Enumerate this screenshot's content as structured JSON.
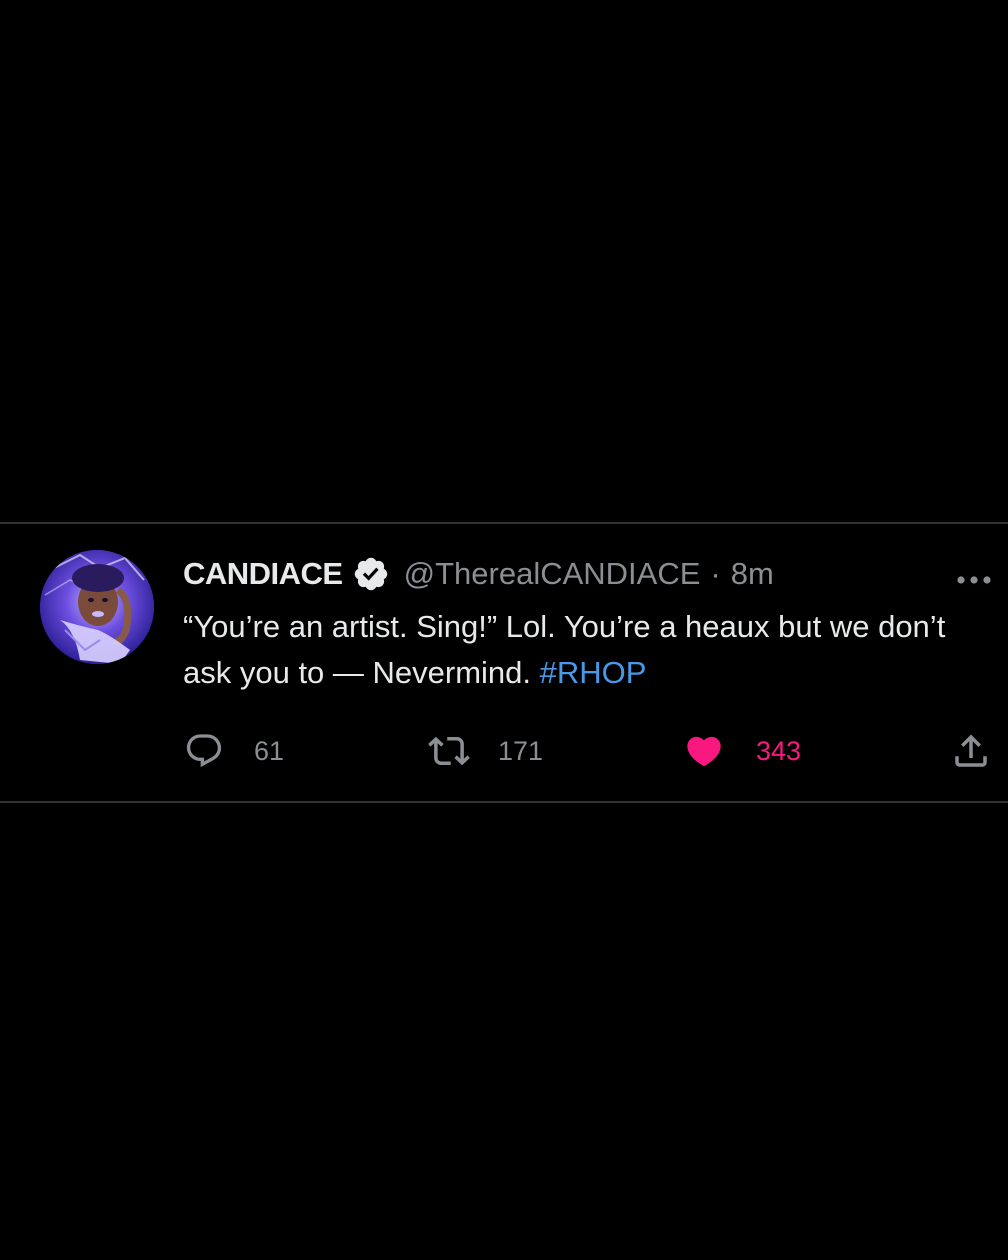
{
  "tweet": {
    "author": {
      "display_name": "CANDIACE",
      "verified": true,
      "handle": "@TherealCANDIACE",
      "separator": "·",
      "time": "8m"
    },
    "text_before_hashtag": "“You’re an artist. Sing!” Lol. You’re a heaux but we don’t ask you to — Nevermind. ",
    "hashtag": "#RHOP",
    "stats": {
      "replies": "61",
      "retweets": "171",
      "likes": "343"
    },
    "liked": true
  },
  "icons": {
    "avatar": "profile-photo",
    "verified": "verified-badge-icon",
    "more": "more-options-icon",
    "reply": "reply-icon",
    "retweet": "retweet-icon",
    "like": "heart-icon",
    "share": "share-icon"
  },
  "colors": {
    "background": "#000000",
    "text": "#e7e9ea",
    "secondary": "#8b8f93",
    "link": "#4a99e9",
    "like": "#f91880",
    "divider": "#2f3336"
  }
}
